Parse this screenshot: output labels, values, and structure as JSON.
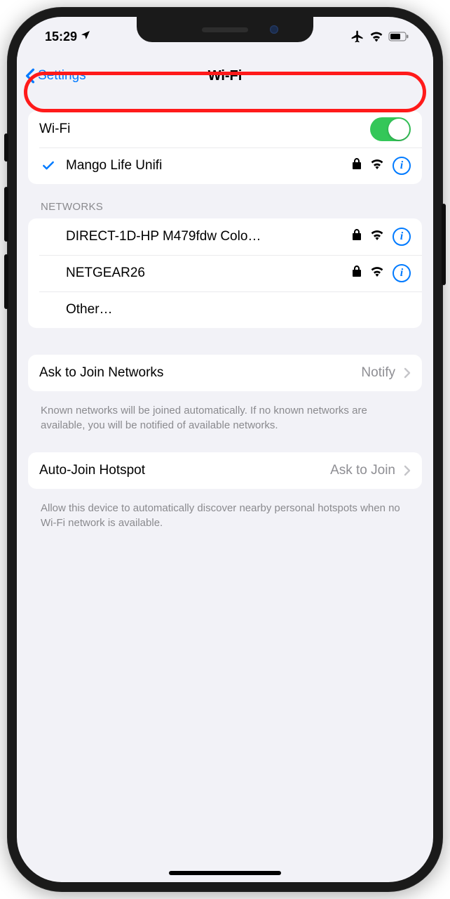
{
  "status_bar": {
    "time": "15:29",
    "location_icon": "location-arrow",
    "airplane_icon": "airplane",
    "wifi_icon": "wifi-signal",
    "battery_icon": "battery"
  },
  "nav": {
    "back_label": "Settings",
    "title": "Wi-Fi"
  },
  "wifi_toggle": {
    "label": "Wi-Fi",
    "enabled": true,
    "highlight_color": "#ff1a1a"
  },
  "connected_network": {
    "name": "Mango Life Unifi",
    "secured": true,
    "signal": "full"
  },
  "networks_header": "Networks",
  "networks": [
    {
      "name": "DIRECT-1D-HP M479fdw Colo…",
      "secured": true,
      "signal": "full"
    },
    {
      "name": "NETGEAR26",
      "secured": true,
      "signal": "full"
    }
  ],
  "other_label": "Other…",
  "ask_to_join": {
    "label": "Ask to Join Networks",
    "value": "Notify",
    "footer": "Known networks will be joined automatically. If no known networks are available, you will be notified of available networks."
  },
  "auto_join": {
    "label": "Auto-Join Hotspot",
    "value": "Ask to Join",
    "footer": "Allow this device to automatically discover nearby personal hotspots when no Wi-Fi network is available."
  },
  "colors": {
    "accent": "#007aff",
    "switch_on": "#34c759",
    "background": "#f2f2f7"
  }
}
